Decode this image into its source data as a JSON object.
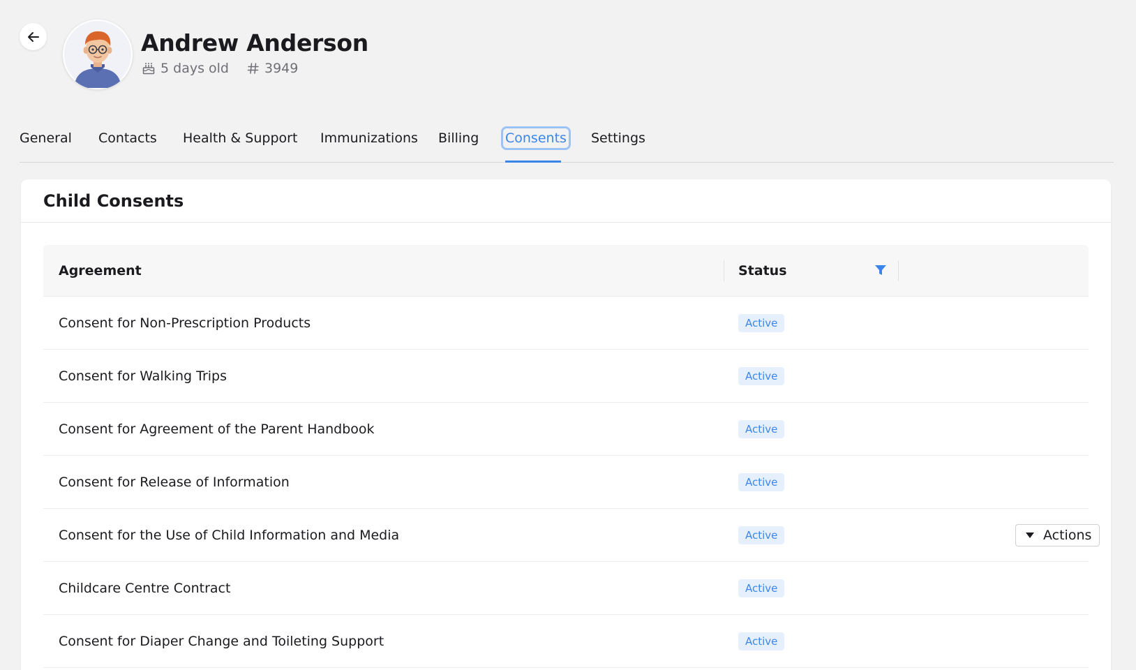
{
  "header": {
    "child_name": "Andrew Anderson",
    "age": "5 days old",
    "child_id": "3949"
  },
  "tabs": [
    {
      "label": "General"
    },
    {
      "label": "Contacts"
    },
    {
      "label": "Health & Support"
    },
    {
      "label": "Immunizations"
    },
    {
      "label": "Billing"
    },
    {
      "label": "Consents"
    },
    {
      "label": "Settings"
    }
  ],
  "active_tab": "Consents",
  "card": {
    "title": "Child Consents"
  },
  "table": {
    "columns": {
      "agreement": "Agreement",
      "status": "Status"
    },
    "rows": [
      {
        "agreement": "Consent for Non-Prescription Products",
        "status": "Active"
      },
      {
        "agreement": "Consent for Walking Trips",
        "status": "Active"
      },
      {
        "agreement": "Consent for Agreement of the Parent Handbook",
        "status": "Active"
      },
      {
        "agreement": "Consent for Release of Information",
        "status": "Active"
      },
      {
        "agreement": "Consent for the Use of Child Information and Media",
        "status": "Active",
        "actions": "Actions"
      },
      {
        "agreement": "Childcare Centre Contract",
        "status": "Active"
      },
      {
        "agreement": "Consent for Diaper Change and Toileting Support",
        "status": "Active"
      }
    ]
  },
  "colors": {
    "accent": "#3a86e8",
    "status_bg": "#e6f0fc",
    "page_bg": "#f2f2f3"
  },
  "icons": {
    "back": "arrow-left-icon",
    "birthday": "cake-icon",
    "id": "hash-icon",
    "filter": "filter-icon",
    "dropdown": "caret-down-icon"
  }
}
